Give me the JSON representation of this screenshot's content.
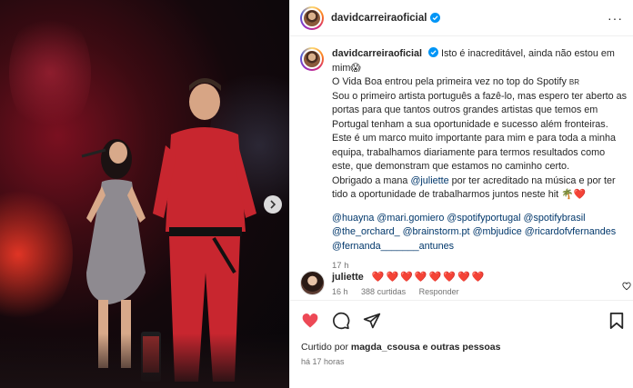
{
  "post": {
    "username": "davidcarreiraoficial",
    "caption": {
      "line1": "Isto é inacreditável, ainda não estou em mim😱",
      "line2a": "O Vida Boa entrou pela primeira vez no top do Spotify",
      "line2b": "BR",
      "line3": "Sou o primeiro artista português a fazê-lo, mas espero ter aberto as portas para que tantos outros grandes artistas que temos em Portugal tenham a sua oportunidade e sucesso além fronteiras.",
      "line4": "Este é um marco muito importante para mim e para toda a minha equipa, trabalhamos diariamente para termos resultados como este, que demonstram que estamos no caminho certo.",
      "line5a": "Obrigado a mana",
      "mention_juliette": "@juliette",
      "line5b": "por ter acreditado na música e por ter tido a oportunidade de trabalharmos juntos neste hit 🌴❤️",
      "tags": [
        "@huayna",
        "@mari.gomiero",
        "@spotifyportugal",
        "@spotifybrasil",
        "@the_orchard_",
        "@brainstorm.pt",
        "@mbjudice",
        "@ricardofvfernandes",
        "@fernanda_______antunes"
      ],
      "time": "17 h"
    }
  },
  "comment": {
    "username": "juliette",
    "text": "❤️❤️❤️❤️❤️❤️❤️❤️",
    "time": "16 h",
    "likes": "388 curtidas",
    "reply": "Responder"
  },
  "actions": {
    "liked_by_prefix": "Curtido por",
    "liked_by_user": "magda_csousa",
    "liked_by_suffix": "e outras pessoas",
    "ago": "há 17 horas"
  },
  "colors": {
    "heart_red": "#ed4956",
    "verified_blue": "#0095f6",
    "link_blue": "#00376b"
  }
}
